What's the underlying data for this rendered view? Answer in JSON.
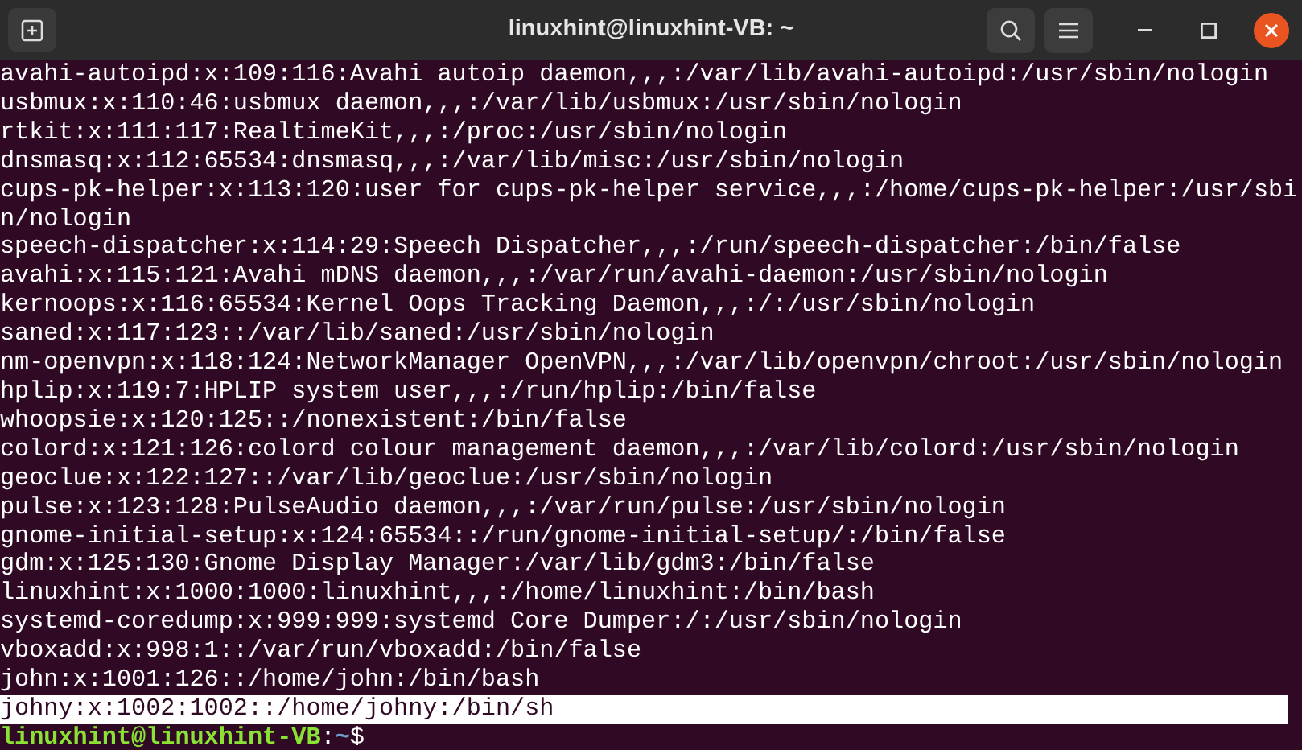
{
  "window": {
    "title": "linuxhint@linuxhint-VB: ~"
  },
  "terminal": {
    "lines": [
      {
        "text": "avahi-autoipd:x:109:116:Avahi autoip daemon,,,:/var/lib/avahi-autoipd:/usr/sbin/nologin",
        "selected": false
      },
      {
        "text": "usbmux:x:110:46:usbmux daemon,,,:/var/lib/usbmux:/usr/sbin/nologin",
        "selected": false
      },
      {
        "text": "rtkit:x:111:117:RealtimeKit,,,:/proc:/usr/sbin/nologin",
        "selected": false
      },
      {
        "text": "dnsmasq:x:112:65534:dnsmasq,,,:/var/lib/misc:/usr/sbin/nologin",
        "selected": false
      },
      {
        "text": "cups-pk-helper:x:113:120:user for cups-pk-helper service,,,:/home/cups-pk-helper:/usr/sbi",
        "selected": false
      },
      {
        "text": "n/nologin",
        "selected": false
      },
      {
        "text": "speech-dispatcher:x:114:29:Speech Dispatcher,,,:/run/speech-dispatcher:/bin/false",
        "selected": false
      },
      {
        "text": "avahi:x:115:121:Avahi mDNS daemon,,,:/var/run/avahi-daemon:/usr/sbin/nologin",
        "selected": false
      },
      {
        "text": "kernoops:x:116:65534:Kernel Oops Tracking Daemon,,,:/:/usr/sbin/nologin",
        "selected": false
      },
      {
        "text": "saned:x:117:123::/var/lib/saned:/usr/sbin/nologin",
        "selected": false
      },
      {
        "text": "nm-openvpn:x:118:124:NetworkManager OpenVPN,,,:/var/lib/openvpn/chroot:/usr/sbin/nologin",
        "selected": false
      },
      {
        "text": "hplip:x:119:7:HPLIP system user,,,:/run/hplip:/bin/false",
        "selected": false
      },
      {
        "text": "whoopsie:x:120:125::/nonexistent:/bin/false",
        "selected": false
      },
      {
        "text": "colord:x:121:126:colord colour management daemon,,,:/var/lib/colord:/usr/sbin/nologin",
        "selected": false
      },
      {
        "text": "geoclue:x:122:127::/var/lib/geoclue:/usr/sbin/nologin",
        "selected": false
      },
      {
        "text": "pulse:x:123:128:PulseAudio daemon,,,:/var/run/pulse:/usr/sbin/nologin",
        "selected": false
      },
      {
        "text": "gnome-initial-setup:x:124:65534::/run/gnome-initial-setup/:/bin/false",
        "selected": false
      },
      {
        "text": "gdm:x:125:130:Gnome Display Manager:/var/lib/gdm3:/bin/false",
        "selected": false
      },
      {
        "text": "linuxhint:x:1000:1000:linuxhint,,,:/home/linuxhint:/bin/bash",
        "selected": false
      },
      {
        "text": "systemd-coredump:x:999:999:systemd Core Dumper:/:/usr/sbin/nologin",
        "selected": false
      },
      {
        "text": "vboxadd:x:998:1::/var/run/vboxadd:/bin/false",
        "selected": false
      },
      {
        "text": "john:x:1001:126::/home/john:/bin/bash",
        "selected": false
      },
      {
        "text": "johny:x:1002:1002::/home/johny:/bin/sh",
        "selected": true
      }
    ],
    "prompt": {
      "user_host": "linuxhint@linuxhint-VB",
      "separator": ":",
      "path": "~",
      "symbol": "$"
    }
  }
}
